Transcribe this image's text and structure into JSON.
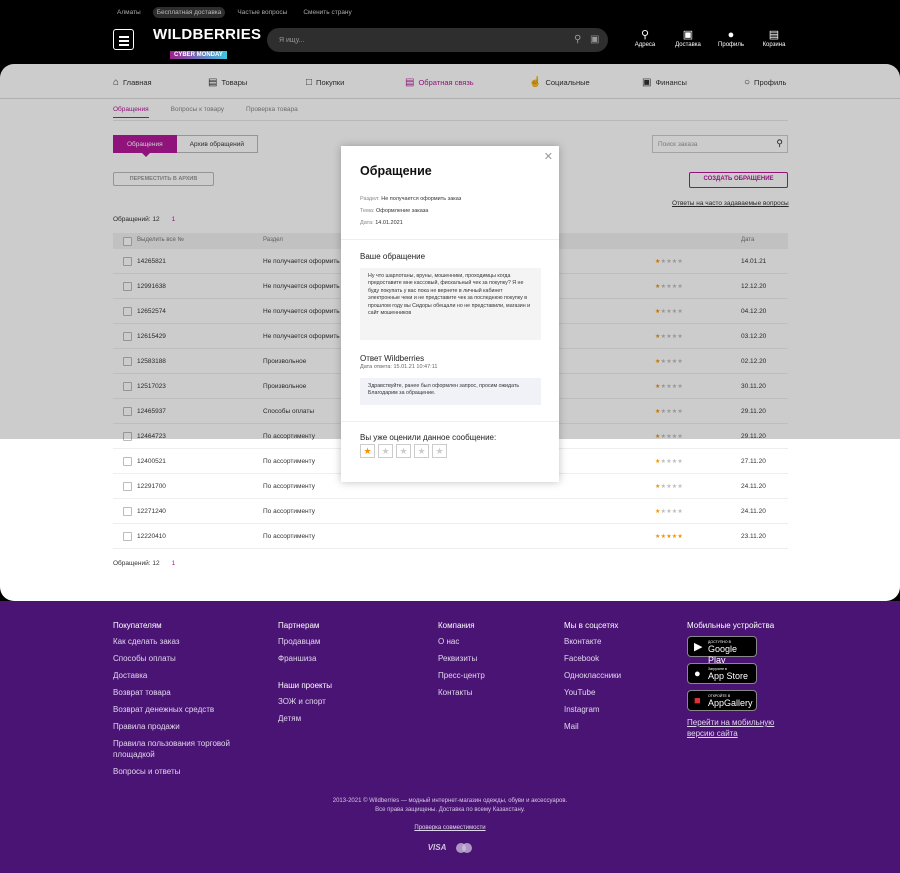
{
  "header": {
    "top_links": [
      "Алматы",
      "Бесплатная доставка",
      "Частые вопросы",
      "Сменить страну"
    ],
    "logo": "WILDBERRIES",
    "logo_sub": "CYBER MONDAY",
    "search_placeholder": "Я ищу...",
    "icons": [
      {
        "label": "Адреса",
        "icon": "location-icon"
      },
      {
        "label": "Доставка",
        "icon": "box-icon"
      },
      {
        "label": "Профиль",
        "icon": "user-icon"
      },
      {
        "label": "Корзина",
        "icon": "cart-icon"
      }
    ]
  },
  "nav": {
    "items": [
      "Главная",
      "Товары",
      "Покупки",
      "Обратная связь",
      "Социальные",
      "Финансы",
      "Профиль"
    ]
  },
  "subtabs": [
    "Обращения",
    "Вопросы к товару",
    "Проверка товара"
  ],
  "segment": {
    "active": "Обращения",
    "archive": "Архив обращений"
  },
  "order_search_placeholder": "Поиск заказа",
  "move_button": "ПЕРЕМЕСТИТЬ В АРХИВ",
  "create_button": "СОЗДАТЬ ОБРАЩЕНИЕ",
  "faq_link": "Ответы на часто задаваемые вопросы",
  "count_label": "Обращений: 12",
  "count_page": "1",
  "table": {
    "headers": {
      "select": "Выделить все №",
      "section": "Раздел",
      "date": "Дата"
    },
    "rows": [
      {
        "num": "14265821",
        "section": "Не получается оформить",
        "rating": 1,
        "date": "14.01.21"
      },
      {
        "num": "12991638",
        "section": "Не получается оформить",
        "rating": 1,
        "date": "12.12.20"
      },
      {
        "num": "12652574",
        "section": "Не получается оформить",
        "rating": 1,
        "date": "04.12.20"
      },
      {
        "num": "12615429",
        "section": "Не получается оформить",
        "rating": 1,
        "date": "03.12.20"
      },
      {
        "num": "12583188",
        "section": "Произвольное",
        "rating": 1,
        "date": "02.12.20"
      },
      {
        "num": "12517023",
        "section": "Произвольное",
        "rating": 1,
        "date": "30.11.20"
      },
      {
        "num": "12465937",
        "section": "Способы оплаты",
        "rating": 1,
        "date": "29.11.20"
      },
      {
        "num": "12464723",
        "section": "По ассортименту",
        "rating": 1,
        "date": "29.11.20"
      },
      {
        "num": "12400521",
        "section": "По ассортименту",
        "rating": 1,
        "date": "27.11.20"
      },
      {
        "num": "12291700",
        "section": "По ассортименту",
        "rating": 1,
        "date": "24.11.20"
      },
      {
        "num": "12271240",
        "section": "По ассортименту",
        "rating": 1,
        "date": "24.11.20"
      },
      {
        "num": "12220410",
        "section": "По ассортименту",
        "rating": 5,
        "date": "23.11.20"
      }
    ]
  },
  "modal": {
    "title": "Обращение",
    "section_key": "Раздел:",
    "section_val": "Не получается оформить заказ",
    "topic_key": "Тема:",
    "topic_val": "Оформление заказа",
    "date_key": "Дата:",
    "date_val": "14.01.2021",
    "your_request_title": "Ваше обращение",
    "your_request_text": "Ну что шарлотаны, вруны, мошенники, проходимцы когда предоставите мне кассовый, фискальный чек за покупку? Я не буду покупать у вас пока не вернете в личный кабинет электронные чеки и не представите чек за последнюю покупку в прошлом году вы Сидоры обещали но не представили, магазин и сайт мошенников",
    "answer_title": "Ответ Wildberries",
    "answer_date": "Дата ответа: 15.01.21 10:47:11",
    "answer_text": "Здравствуйте, ранее был оформлен запрос, просим ожидать Благодарим за обращение.",
    "rated_title": "Вы уже оценили данное сообщение:",
    "rating": 1
  },
  "footer": {
    "buyers_title": "Покупателям",
    "buyers": [
      "Как сделать заказ",
      "Способы оплаты",
      "Доставка",
      "Возврат товара",
      "Возврат денежных средств",
      "Правила продажи",
      "Правила пользования торговой площадкой",
      "Вопросы и ответы"
    ],
    "partners_title": "Партнерам",
    "partners": [
      "Продавцам",
      "Франшиза"
    ],
    "projects_title": "Наши проекты",
    "projects": [
      "ЗОЖ и спорт",
      "Детям"
    ],
    "company_title": "Компания",
    "company": [
      "О нас",
      "Реквизиты",
      "Пресс-центр",
      "Контакты"
    ],
    "social_title": "Мы в соцсетях",
    "social": [
      "Вконтакте",
      "Facebook",
      "Одноклассники",
      "YouTube",
      "Instagram",
      "Mail"
    ],
    "mobile_title": "Мобильные устройства",
    "stores": [
      {
        "small": "ДОСТУПНО В",
        "big": "Google Play",
        "icon": "google-play-icon"
      },
      {
        "small": "Загрузите в",
        "big": "App Store",
        "icon": "apple-icon"
      },
      {
        "small": "ОТКРОЙТЕ В",
        "big": "AppGallery",
        "icon": "huawei-icon"
      }
    ],
    "mobile_link": "Перейти на мобильную версию сайта",
    "copyright_1": "2013-2021 © Wildberries — модный интернет-магазин одежды, обуви и аксессуаров.",
    "copyright_2": "Все права защищены. Доставка по всему Казахстану.",
    "compat": "Проверка совместимости",
    "visa": "VISA"
  }
}
